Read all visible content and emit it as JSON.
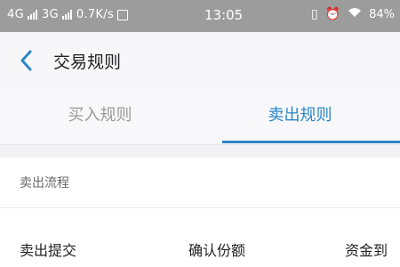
{
  "statusbar": {
    "net1": "4G",
    "net2": "3G",
    "speed": "0.7K/s",
    "time": "13:05",
    "battery": "84%"
  },
  "header": {
    "title": "交易规则"
  },
  "tabs": [
    {
      "label": "买入规则",
      "active": false
    },
    {
      "label": "卖出规则",
      "active": true
    }
  ],
  "section": {
    "title": "卖出流程"
  },
  "steps": [
    "卖出提交",
    "确认份额",
    "资金到"
  ],
  "colors": {
    "accent": "#2b86c8",
    "statusbar": "#9c9c9c"
  }
}
